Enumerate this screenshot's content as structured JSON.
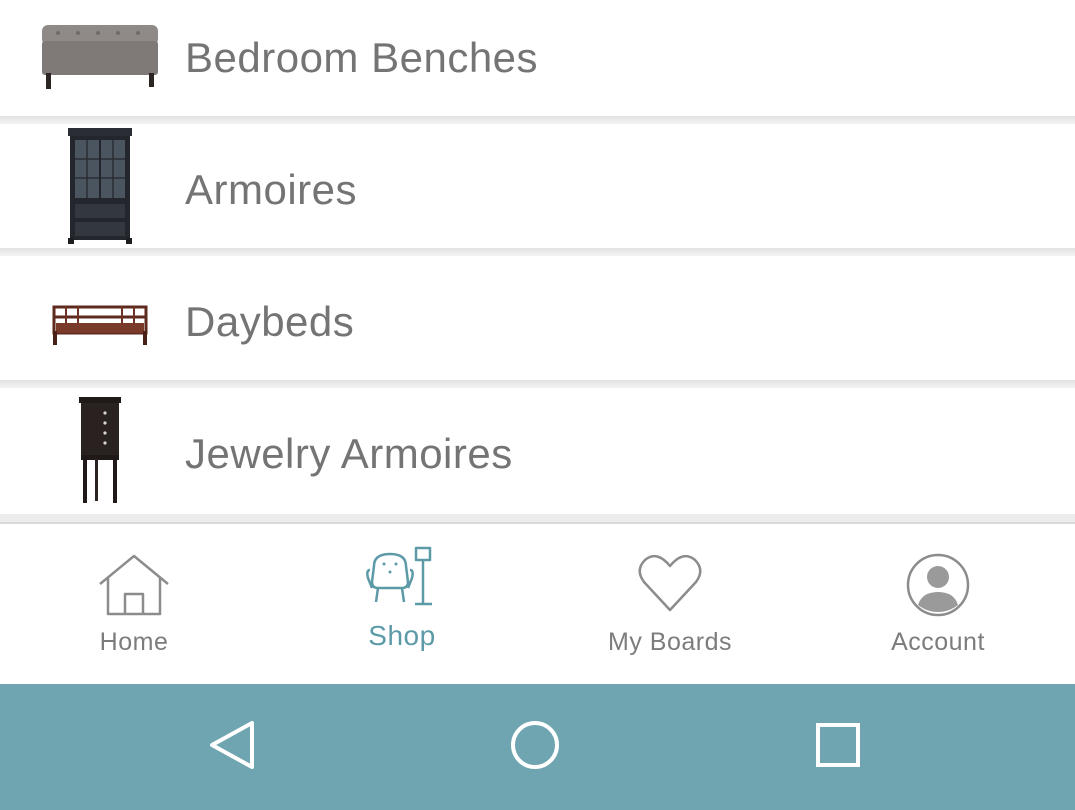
{
  "categories": [
    {
      "label": "Bedroom Benches",
      "icon": "bench-thumbnail"
    },
    {
      "label": "Armoires",
      "icon": "armoire-thumbnail"
    },
    {
      "label": "Daybeds",
      "icon": "daybed-thumbnail"
    },
    {
      "label": "Jewelry Armoires",
      "icon": "jewelry-armoire-thumbnail"
    }
  ],
  "tabbar": {
    "tabs": [
      {
        "label": "Home",
        "icon": "home-icon",
        "active": false
      },
      {
        "label": "Shop",
        "icon": "shop-icon",
        "active": true
      },
      {
        "label": "My Boards",
        "icon": "heart-icon",
        "active": false
      },
      {
        "label": "Account",
        "icon": "account-icon",
        "active": false
      }
    ]
  },
  "system_nav": {
    "buttons": [
      "back-icon",
      "home-circle-icon",
      "recents-icon"
    ]
  },
  "colors": {
    "accent": "#5d9aa7",
    "nav_bar": "#6fa4b1",
    "label_gray": "#747474"
  }
}
